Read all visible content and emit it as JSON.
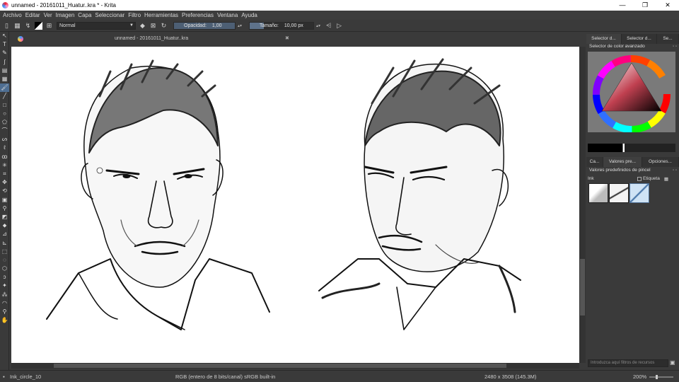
{
  "window": {
    "title": "unnamed - 20161011_Huatur..kra * - Krita"
  },
  "menu": [
    "Archivo",
    "Editar",
    "Ver",
    "Imagen",
    "Capa",
    "Seleccionar",
    "Filtro",
    "Herramientas",
    "Preferencias",
    "Ventana",
    "Ayuda"
  ],
  "toolbar": {
    "blend_mode": "Normal",
    "opacity_label": "Opacidad:",
    "opacity_value": "1,00",
    "size_label": "Tamaño:",
    "size_value": "10,00 px"
  },
  "document": {
    "tab_title": "unnamed - 20161011_Huatur..kra"
  },
  "dock": {
    "top_tabs": [
      "Selector d...",
      "Selector d...",
      "Se..."
    ],
    "color_panel_title": "Selector de color avanzado",
    "mid_tabs": [
      "Ca...",
      "Valores pre...",
      "Opciones..."
    ],
    "presets_title": "Valores predefinidos de pincel",
    "preset_filter": "Ink",
    "tag_label": "Etiqueta",
    "filter_placeholder": "Introduzca aquí filtros de recursos"
  },
  "status": {
    "brush": "Ink_circle_10",
    "color_info": "RGB (entero de 8 bits/canal)  sRGB built-in",
    "image_size": "2480 x 3508 (145.3M)",
    "zoom": "200%"
  },
  "colors": {
    "accent": "#4e6e92",
    "slider": "#4d5f74",
    "background": "#3a3a3a"
  }
}
